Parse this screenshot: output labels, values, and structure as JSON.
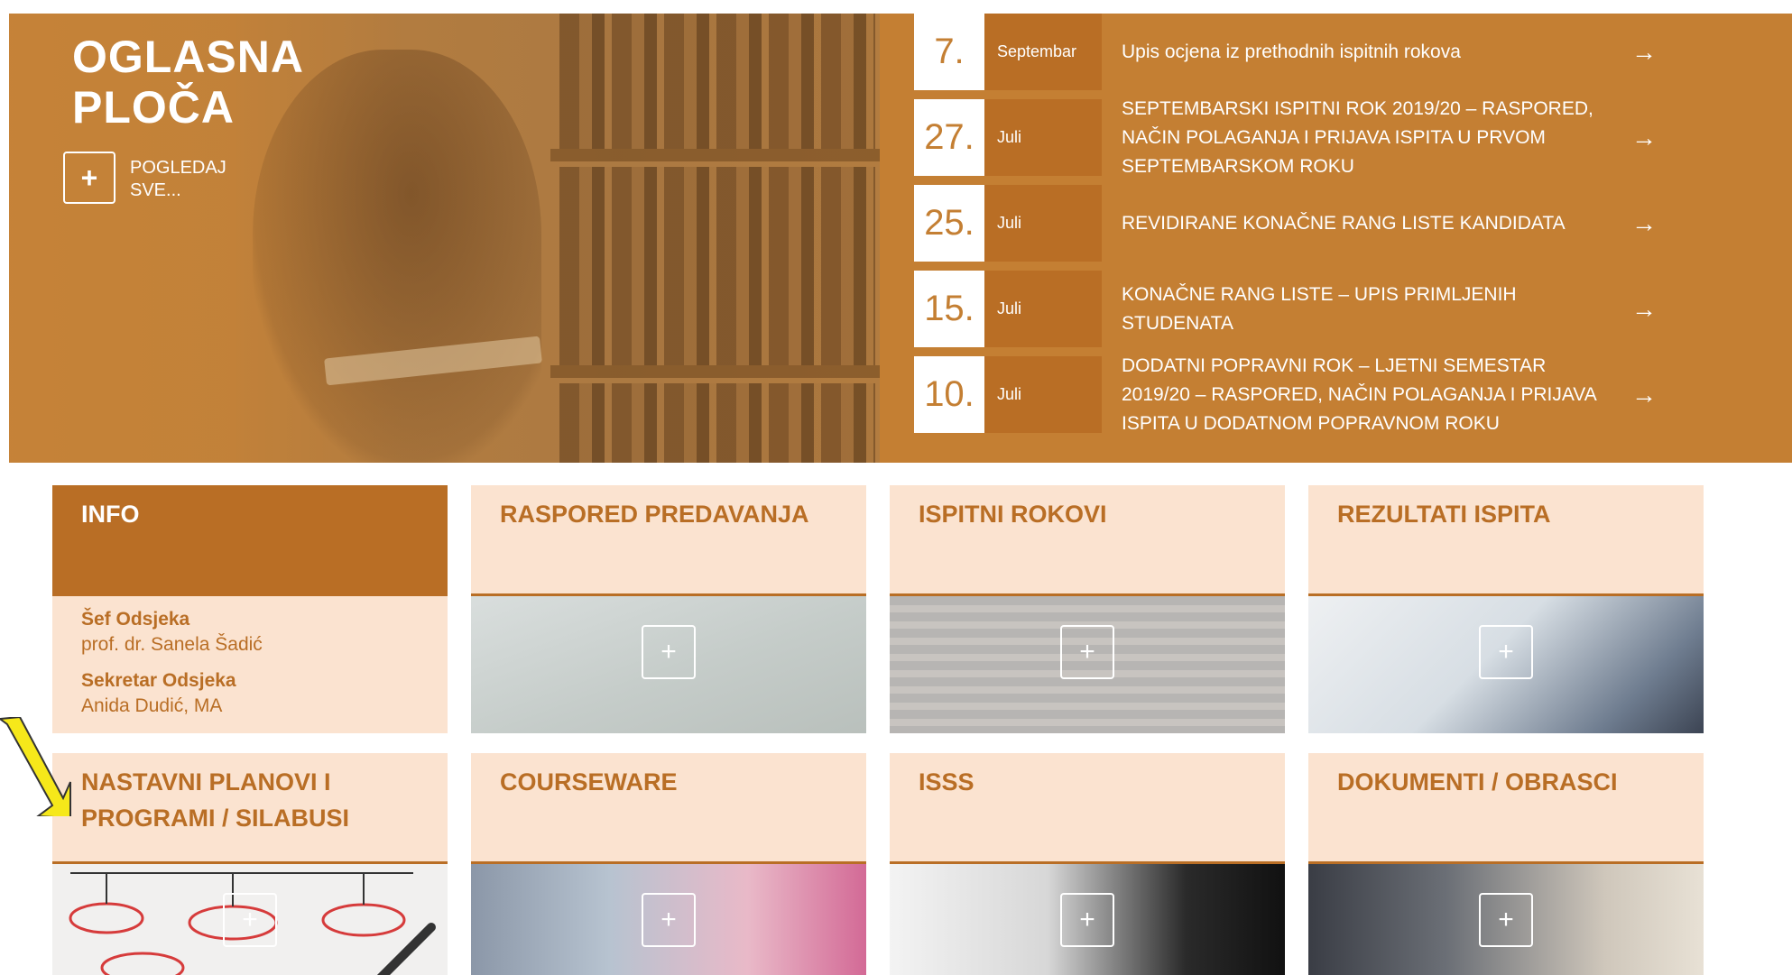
{
  "hero": {
    "title_line1": "OGLASNA",
    "title_line2": "PLOČA",
    "view_all_plus": "+",
    "view_all_label": "POGLEDAJ SVE..."
  },
  "news": [
    {
      "day": "7.",
      "month": "Septembar",
      "title": "Upis ocjena iz prethodnih ispitnih rokova",
      "arrow": "→"
    },
    {
      "day": "27.",
      "month": "Juli",
      "title": "SEPTEMBARSKI ISPITNI ROK 2019/20 – RASPORED, NAČIN POLAGANJA I PRIJAVA ISPITA U PRVOM SEPTEMBARSKOM ROKU",
      "arrow": "→"
    },
    {
      "day": "25.",
      "month": "Juli",
      "title": "REVIDIRANE KONAČNE RANG LISTE KANDIDATA",
      "arrow": "→"
    },
    {
      "day": "15.",
      "month": "Juli",
      "title": "KONAČNE RANG LISTE – UPIS PRIMLJENIH STUDENATA",
      "arrow": "→"
    },
    {
      "day": "10.",
      "month": "Juli",
      "title": "DODATNI POPRAVNI ROK – LJETNI SEMESTAR 2019/20 – RASPORED, NAČIN POLAGANJA I PRIJAVA ISPITA U DODATNOM POPRAVNOM ROKU",
      "arrow": "→"
    }
  ],
  "tiles": {
    "info": {
      "title": "INFO",
      "role1": "Šef Odsjeka",
      "name1": "prof. dr. Sanela Šadić",
      "role2": "Sekretar Odsjeka",
      "name2": "Anida Dudić, MA"
    },
    "raspored": {
      "title": "RASPORED PREDAVANJA",
      "plus": "+"
    },
    "ispitni": {
      "title": "ISPITNI ROKOVI",
      "plus": "+"
    },
    "rezultati": {
      "title": "REZULTATI ISPITA",
      "plus": "+"
    },
    "nastavni": {
      "title": "NASTAVNI PLANOVI I PROGRAMI / SILABUSI",
      "plus": "+"
    },
    "courseware": {
      "title": "COURSEWARE",
      "plus": "+"
    },
    "isss": {
      "title": "ISSS",
      "plus": "+"
    },
    "dokumenti": {
      "title": "DOKUMENTI / OBRASCI",
      "plus": "+"
    }
  },
  "colors": {
    "accent": "#c47f33",
    "accent_dark": "#b96e25",
    "tile_bg": "#fbe3d0",
    "annotation_arrow": "#f6e81a"
  }
}
